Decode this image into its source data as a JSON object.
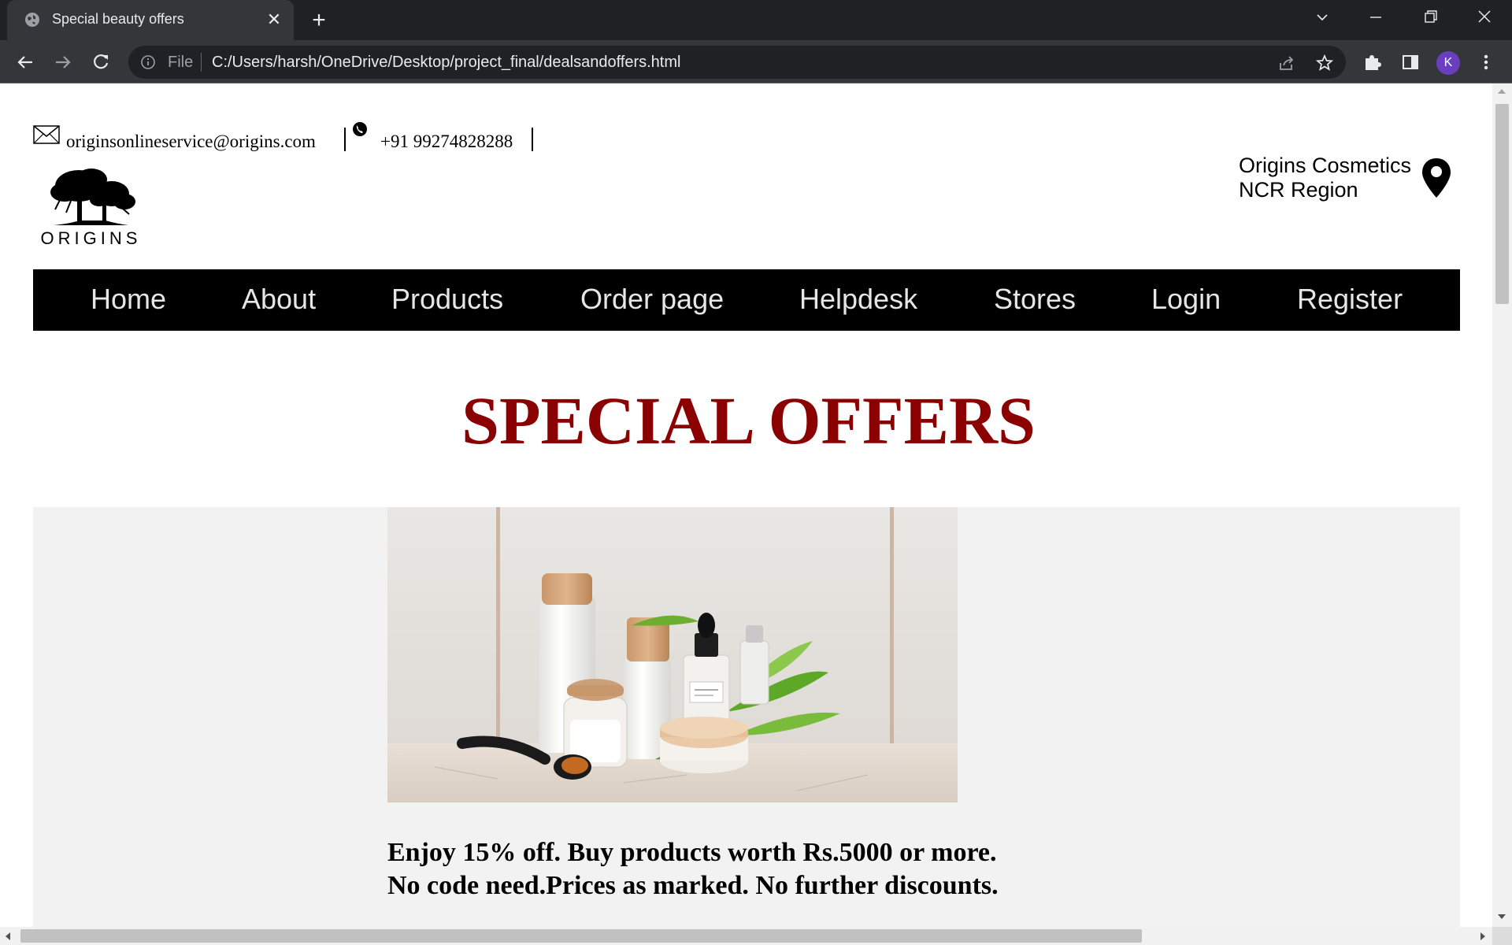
{
  "browser": {
    "tab_title": "Special beauty offers",
    "tab_close": "✕",
    "new_tab": "+",
    "file_label": "File",
    "url": "C:/Users/harsh/OneDrive/Desktop/project_final/dealsandoffers.html",
    "profile_initial": "K",
    "profile_color": "#6a3fbf"
  },
  "header": {
    "email": "originsonlineservice@origins.com",
    "phone": "+91 99274828288",
    "logo_text": "ORIGINS",
    "store_name": "Origins Cosmetics",
    "store_region": "NCR Region"
  },
  "nav": {
    "items": [
      "Home",
      "About",
      "Products",
      "Order page",
      "Helpdesk",
      "Stores",
      "Login",
      "Register"
    ]
  },
  "main": {
    "title": "SPECIAL OFFERS",
    "title_color": "#8b0000",
    "offer_line1": "Enjoy 15% off. Buy products worth Rs.5000 or more.",
    "offer_line2": "No code need.Prices as marked. No further discounts."
  }
}
